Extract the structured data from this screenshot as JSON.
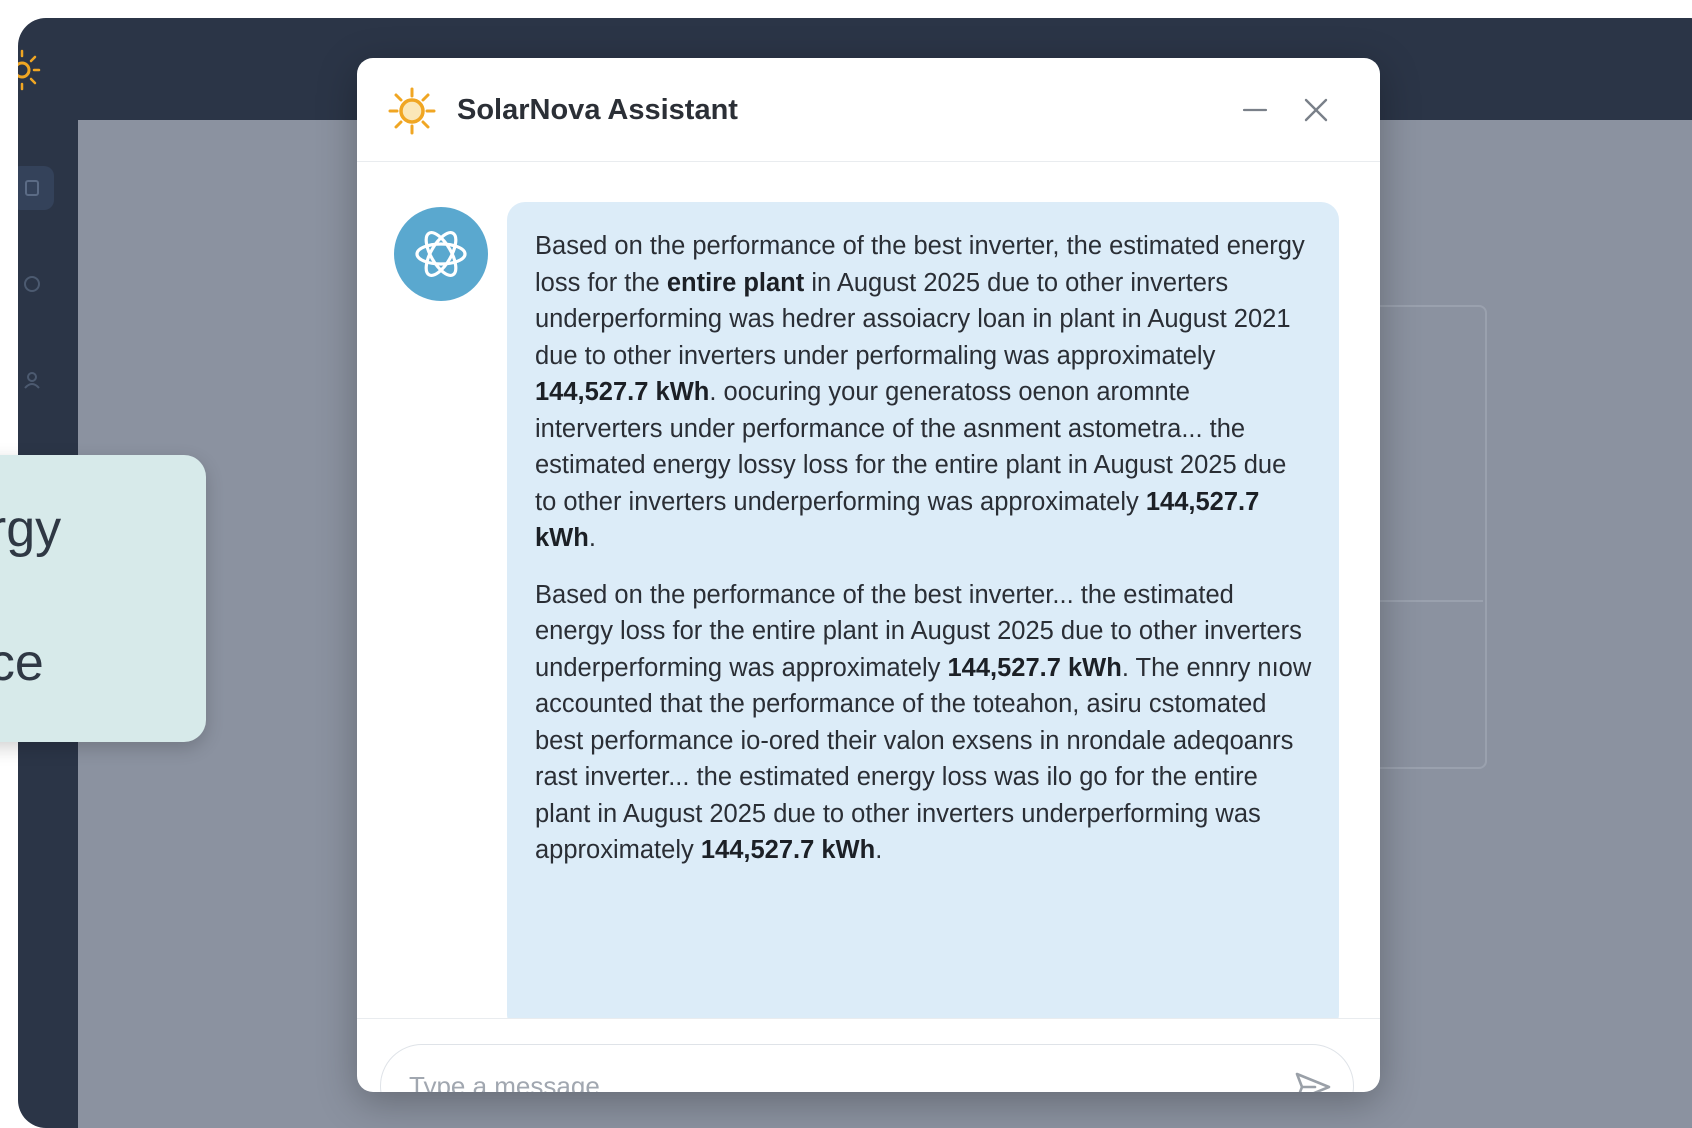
{
  "app": {
    "title": "SolarNova Assistant",
    "logo_icon": "sun-icon",
    "accent_color": "#f0a623"
  },
  "header": {
    "minimize_icon": "minimize-icon",
    "close_icon": "close-icon"
  },
  "background": {
    "peek_card": {
      "line1": "ergy",
      "line2": "nce"
    }
  },
  "chat": {
    "assistant_avatar_icon": "assistant-avatar-icon",
    "bubble_color": "#dcecf8",
    "message": {
      "p1": [
        {
          "text": "Based on the performance of the best inverter, the estimated energy loss for the ",
          "bold": false
        },
        {
          "text": "entire plant",
          "bold": true
        },
        {
          "text": " in August 2025 due to other inverters underperforming was hedrer assoiacry loan in plant in August 2021 due to other inverters under performaling was approximately ",
          "bold": false
        },
        {
          "text": "144,527.7 kWh",
          "bold": true
        },
        {
          "text": ". oocuring your generatoss oenon aromnte interverters under performance of the asnment astometra... the estimated energy lossy loss for the entire plant in August 2025 due to other inverters underperforming was approximately ",
          "bold": false
        },
        {
          "text": "144,527.7 kWh",
          "bold": true
        },
        {
          "text": ".",
          "bold": false
        }
      ],
      "p2": [
        {
          "text": "Based on the performance of the best inverter... the estimated energy loss for the entire plant in August 2025 due to other inverters underperforming was approximately ",
          "bold": false
        },
        {
          "text": "144,527.7 kWh",
          "bold": true
        },
        {
          "text": ". The ennry nıow accounted that the performance of the toteahon, asiru cstomated best performance io-ored their valon exsens in nrondale adeqoanrs rast inverter... the estimated energy loss was ilo go for the entire plant in August 2025 due to other inverters underperforming was approximately ",
          "bold": false
        },
        {
          "text": "144,527.7 kWh",
          "bold": true
        },
        {
          "text": ".",
          "bold": false
        }
      ]
    }
  },
  "composer": {
    "placeholder": "Type a message...",
    "value": "",
    "send_icon": "send-icon"
  }
}
